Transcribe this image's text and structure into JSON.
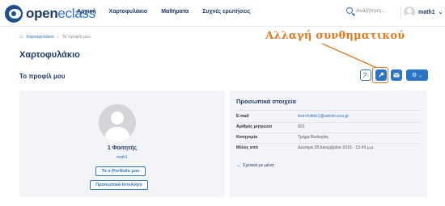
{
  "header": {
    "logo_main": "open",
    "logo_light": "eclass",
    "nav": [
      "Αρχική",
      "Χαρτοφυλάκιο",
      "Μαθήματα",
      "Συχνές ερωτήσεις"
    ],
    "search_placeholder": "Αναζήτηση...",
    "username": "math1"
  },
  "breadcrumb": {
    "link": "Χαρτοφυλάκιο",
    "separator": "›",
    "current": "Το προφίλ μου"
  },
  "page_title": "Χαρτοφυλάκιο",
  "section_title": "Το προφίλ μου",
  "annotation": "Αλλαγή συνθηματικού",
  "toolbar": {
    "icons": [
      "edit-icon",
      "key-icon",
      "mail-icon",
      "gear-icon"
    ],
    "highlighted": "key-icon"
  },
  "profile": {
    "role": "1 Φοιτητής",
    "username": "math1",
    "eportfolio_button": "Το e-Portfolio μου",
    "history_button": "Προσωπικό Ιστολόγιο"
  },
  "personal_info": {
    "title": "Προσωπικά στοιχεία",
    "rows": [
      {
        "label": "E-mail",
        "value": "test+foititis1@admin.uoa.gr"
      },
      {
        "label": "Αριθμός μητρώου",
        "value": "001"
      },
      {
        "label": "Κατηγορία",
        "value": "Τμήμα Βιολογίας"
      },
      {
        "label": "Μέλος από",
        "value": "Δευτέρα 28 Δεκεμβρίου 2015 - 12:43 μ.μ."
      }
    ],
    "more": "Σχετικά με μένα"
  },
  "colors": {
    "brand": "#1e3a66",
    "accent": "#2c74c4",
    "annotation": "#e07a1f"
  }
}
